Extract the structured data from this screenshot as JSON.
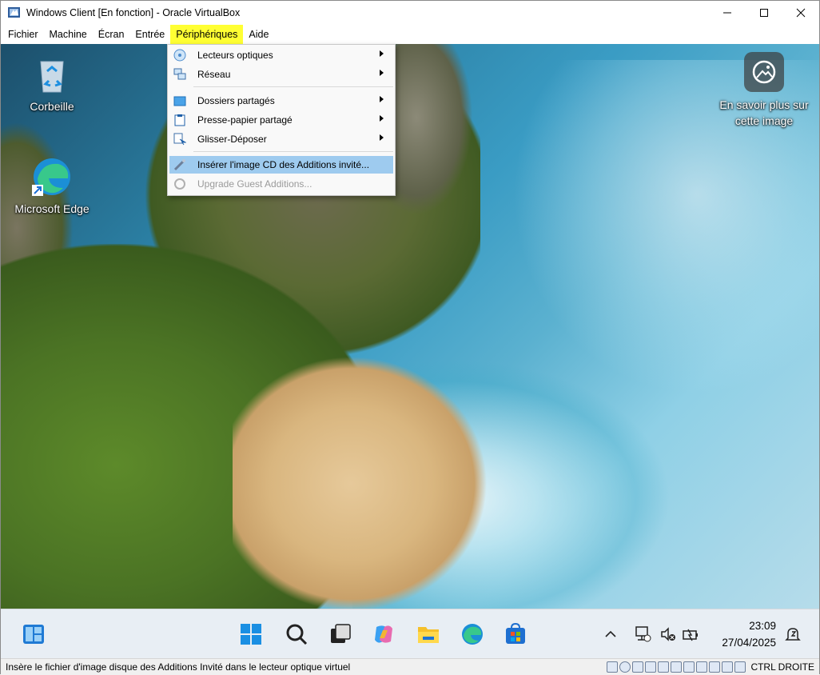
{
  "window": {
    "title": "Windows Client [En fonction] - Oracle VirtualBox"
  },
  "menubar": {
    "items": [
      "Fichier",
      "Machine",
      "Écran",
      "Entrée",
      "Périphériques",
      "Aide"
    ]
  },
  "desktop": {
    "recycle_bin": "Corbeille",
    "edge": "Microsoft Edge",
    "learn_more": "En savoir plus sur cette image"
  },
  "devices_menu": {
    "items": [
      {
        "label": "Lecteurs optiques",
        "submenu": true
      },
      {
        "label": "Réseau",
        "submenu": true
      },
      {
        "label": "Dossiers partagés",
        "submenu": true
      },
      {
        "label": "Presse-papier partagé",
        "submenu": true
      },
      {
        "label": "Glisser-Déposer",
        "submenu": true
      },
      {
        "label": "Insérer l'image CD des Additions invité...",
        "selected": true
      },
      {
        "label": "Upgrade Guest Additions...",
        "disabled": true
      }
    ]
  },
  "taskbar": {
    "time": "23:09",
    "date": "27/04/2025"
  },
  "statusbar": {
    "text": "Insère le fichier d'image disque des Additions Invité dans le lecteur optique virtuel",
    "host_key": "CTRL DROITE"
  }
}
